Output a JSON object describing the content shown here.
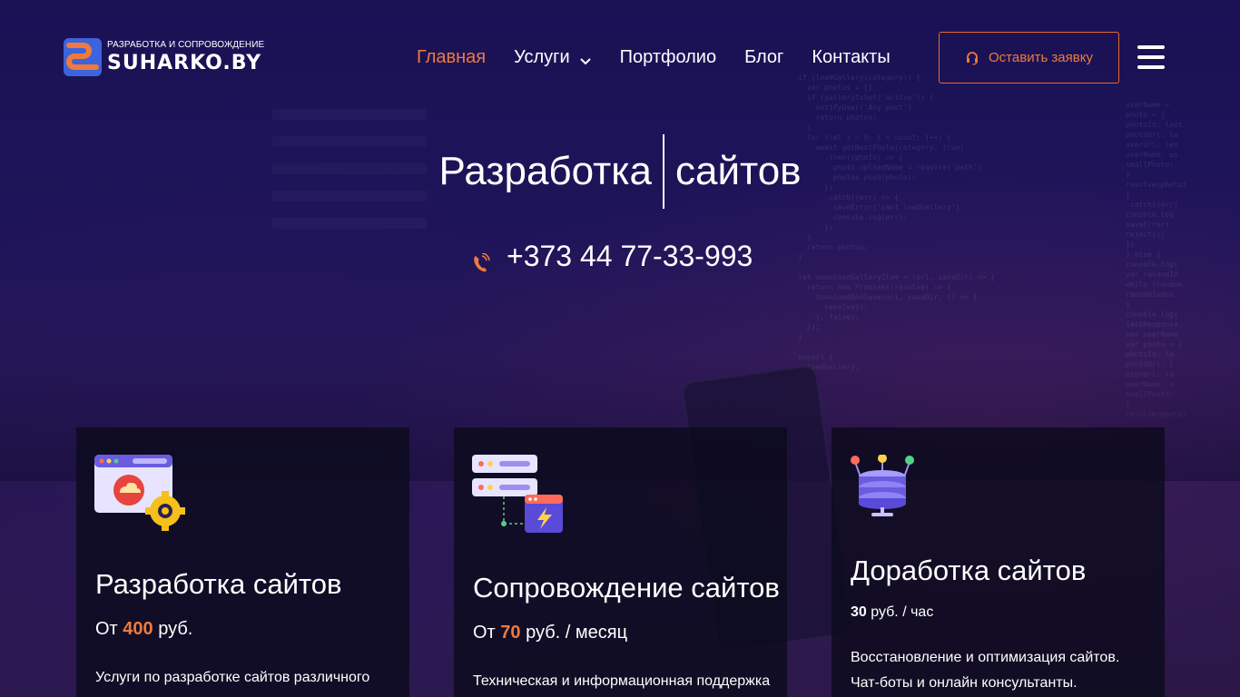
{
  "brand": {
    "tagline": "РАЗРАБОТКА И СОПРОВОЖДЕНИЕ",
    "name": "SUHARKO.BY",
    "accent": "#f07a3c"
  },
  "nav": {
    "items": [
      {
        "label": "Главная",
        "active": true
      },
      {
        "label": "Услуги",
        "active": false,
        "has_dropdown": true
      },
      {
        "label": "Портфолио",
        "active": false
      },
      {
        "label": "Блог",
        "active": false
      },
      {
        "label": "Контакты",
        "active": false
      }
    ],
    "cta_label": "Оставить заявку",
    "cta_icon": "headset-icon",
    "menu_icon": "hamburger-menu-icon"
  },
  "hero": {
    "title_word1": "Разработка",
    "title_word2": "сайтов",
    "phone": "+373 44 77-33-993",
    "phone_icon": "phone-ringing-icon"
  },
  "cards": [
    {
      "icon": "browser-gear-icon",
      "title": "Разработка сайтов",
      "price_prefix": "От ",
      "price_value": "400",
      "price_suffix": " руб.",
      "description": "Услуги по разработке сайтов различного"
    },
    {
      "icon": "server-window-icon",
      "title": "Сопровождение сайтов",
      "price_prefix": "От ",
      "price_value": "70",
      "price_suffix": " руб. / месяц",
      "description": "Техническая и информационная поддержка"
    },
    {
      "icon": "database-network-icon",
      "title": "Доработка сайтов",
      "price_value": "30",
      "price_suffix": " руб. / час",
      "description_line1": "Восстановление и оптимизация сайтов.",
      "description_line2": "Чат-боты и онлайн консультанты."
    }
  ]
}
